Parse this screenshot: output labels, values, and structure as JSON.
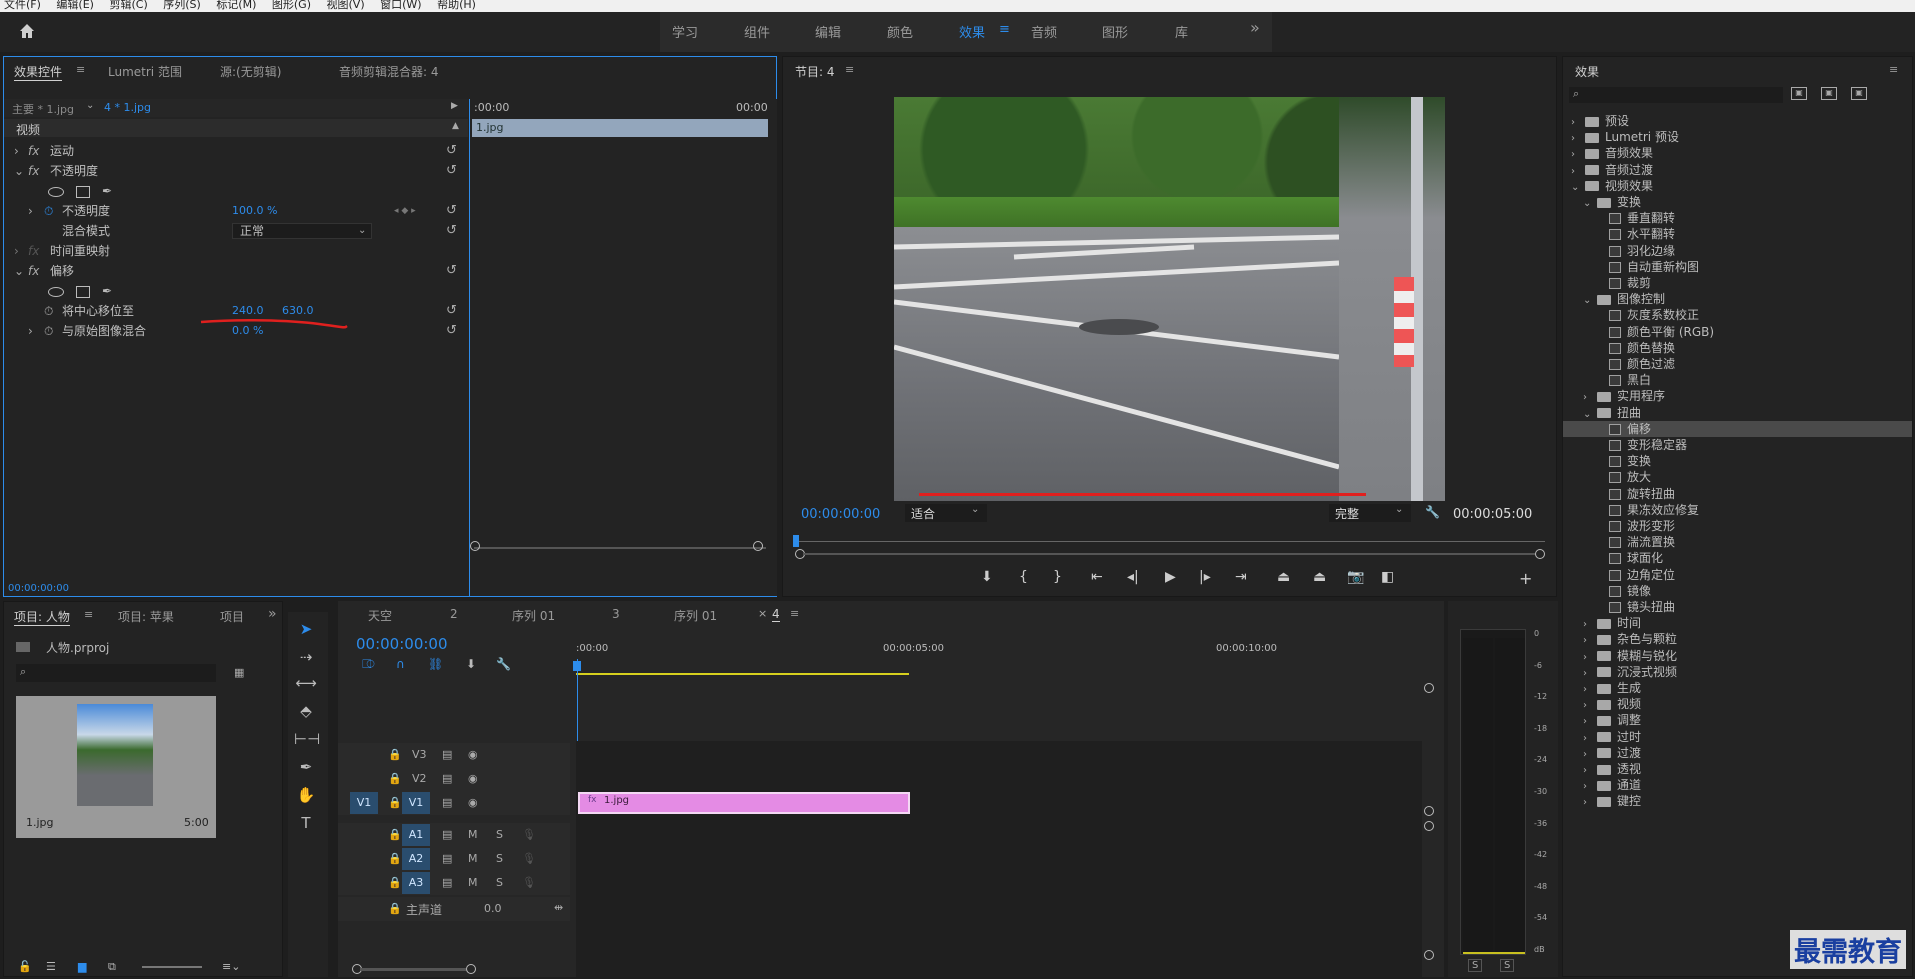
{
  "menu": [
    "文件(F)",
    "编辑(E)",
    "剪辑(C)",
    "序列(S)",
    "标记(M)",
    "图形(G)",
    "视图(V)",
    "窗口(W)",
    "帮助(H)"
  ],
  "workspaces": [
    "学习",
    "组件",
    "编辑",
    "颜色",
    "效果",
    "音频",
    "图形",
    "库"
  ],
  "workspace_active": "效果",
  "more_glyph": "»",
  "effect_controls": {
    "tabs": [
      "效果控件",
      "Lumetri 范围",
      "源:(无剪辑)",
      "音频剪辑混合器: 4"
    ],
    "master_label": "主要 * 1.jpg",
    "clip_selector": "4 * 1.jpg",
    "ruler_start": ":00:00",
    "ruler_end": "00:00",
    "clip_name": "1.jpg",
    "video_section": "视频",
    "fx_motion": "运动",
    "fx_opacity": "不透明度",
    "opacity_label": "不透明度",
    "opacity_value": "100.0 %",
    "blend_label": "混合模式",
    "blend_value": "正常",
    "time_remap": "时间重映射",
    "fx_offset": "偏移",
    "shift_center_label": "将中心移位至",
    "shift_x": "240.0",
    "shift_y": "630.0",
    "blend_original_label": "与原始图像混合",
    "blend_original_value": "0.0 %",
    "timecode": "00:00:00:00"
  },
  "program": {
    "title": "节目: 4",
    "timecode_in": "00:00:00:00",
    "fit_label": "适合",
    "quality_label": "完整",
    "duration": "00:00:05:00"
  },
  "effects_panel": {
    "title": "效果",
    "tree": [
      {
        "label": "预设",
        "level": 0,
        "type": "folder",
        "open": false
      },
      {
        "label": "Lumetri 预设",
        "level": 0,
        "type": "folder",
        "open": false
      },
      {
        "label": "音频效果",
        "level": 0,
        "type": "folder",
        "open": false
      },
      {
        "label": "音频过渡",
        "level": 0,
        "type": "folder",
        "open": false
      },
      {
        "label": "视频效果",
        "level": 0,
        "type": "folder",
        "open": true
      },
      {
        "label": "变换",
        "level": 1,
        "type": "folder",
        "open": true
      },
      {
        "label": "垂直翻转",
        "level": 2,
        "type": "fx"
      },
      {
        "label": "水平翻转",
        "level": 2,
        "type": "fx"
      },
      {
        "label": "羽化边缘",
        "level": 2,
        "type": "fx"
      },
      {
        "label": "自动重新构图",
        "level": 2,
        "type": "fx"
      },
      {
        "label": "裁剪",
        "level": 2,
        "type": "fx"
      },
      {
        "label": "图像控制",
        "level": 1,
        "type": "folder",
        "open": true
      },
      {
        "label": "灰度系数校正",
        "level": 2,
        "type": "fx"
      },
      {
        "label": "颜色平衡 (RGB)",
        "level": 2,
        "type": "fx"
      },
      {
        "label": "颜色替换",
        "level": 2,
        "type": "fx"
      },
      {
        "label": "颜色过滤",
        "level": 2,
        "type": "fx"
      },
      {
        "label": "黑白",
        "level": 2,
        "type": "fx"
      },
      {
        "label": "实用程序",
        "level": 1,
        "type": "folder",
        "open": false
      },
      {
        "label": "扭曲",
        "level": 1,
        "type": "folder",
        "open": true
      },
      {
        "label": "偏移",
        "level": 2,
        "type": "fx",
        "selected": true
      },
      {
        "label": "变形稳定器",
        "level": 2,
        "type": "fx"
      },
      {
        "label": "变换",
        "level": 2,
        "type": "fx"
      },
      {
        "label": "放大",
        "level": 2,
        "type": "fx"
      },
      {
        "label": "旋转扭曲",
        "level": 2,
        "type": "fx"
      },
      {
        "label": "果冻效应修复",
        "level": 2,
        "type": "fx"
      },
      {
        "label": "波形变形",
        "level": 2,
        "type": "fx"
      },
      {
        "label": "湍流置换",
        "level": 2,
        "type": "fx"
      },
      {
        "label": "球面化",
        "level": 2,
        "type": "fx"
      },
      {
        "label": "边角定位",
        "level": 2,
        "type": "fx"
      },
      {
        "label": "镜像",
        "level": 2,
        "type": "fx"
      },
      {
        "label": "镜头扭曲",
        "level": 2,
        "type": "fx"
      },
      {
        "label": "时间",
        "level": 1,
        "type": "folder",
        "open": false
      },
      {
        "label": "杂色与颗粒",
        "level": 1,
        "type": "folder",
        "open": false
      },
      {
        "label": "模糊与锐化",
        "level": 1,
        "type": "folder",
        "open": false
      },
      {
        "label": "沉浸式视频",
        "level": 1,
        "type": "folder",
        "open": false
      },
      {
        "label": "生成",
        "level": 1,
        "type": "folder",
        "open": false
      },
      {
        "label": "视频",
        "level": 1,
        "type": "folder",
        "open": false
      },
      {
        "label": "调整",
        "level": 1,
        "type": "folder",
        "open": false
      },
      {
        "label": "过时",
        "level": 1,
        "type": "folder",
        "open": false
      },
      {
        "label": "过渡",
        "level": 1,
        "type": "folder",
        "open": false
      },
      {
        "label": "透视",
        "level": 1,
        "type": "folder",
        "open": false
      },
      {
        "label": "通道",
        "level": 1,
        "type": "folder",
        "open": false
      },
      {
        "label": "键控",
        "level": 1,
        "type": "folder",
        "open": false
      }
    ]
  },
  "project": {
    "tabs": [
      "项目: 人物",
      "项目: 苹果",
      "项目"
    ],
    "file": "人物.prproj",
    "item_name": "1.jpg",
    "item_duration": "5:00"
  },
  "timeline": {
    "tabs": [
      "天空",
      "2",
      "序列 01",
      "3",
      "序列 01",
      "4"
    ],
    "timecode": "00:00:00:00",
    "ruler": [
      ":00:00",
      "00:00:05:00",
      "00:00:10:00"
    ],
    "video_tracks": [
      "V3",
      "V2",
      "V1"
    ],
    "audio_tracks": [
      "A1",
      "A2",
      "A3"
    ],
    "source_patch": "V1",
    "master_label": "主声道",
    "master_value": "0.0",
    "clip_name": "1.jpg",
    "m_label": "M",
    "s_label": "S"
  },
  "meter_scale": [
    "0",
    "-6",
    "-12",
    "-18",
    "-24",
    "-30",
    "-36",
    "-42",
    "-48",
    "-54",
    "dB"
  ],
  "meter_solo": [
    "S",
    "S"
  ],
  "watermark": "最需教育",
  "colors": {
    "accent": "#2d8ceb",
    "clip": "#e48be4",
    "annotation": "#e0201e",
    "work_area": "#d6cf1e"
  }
}
